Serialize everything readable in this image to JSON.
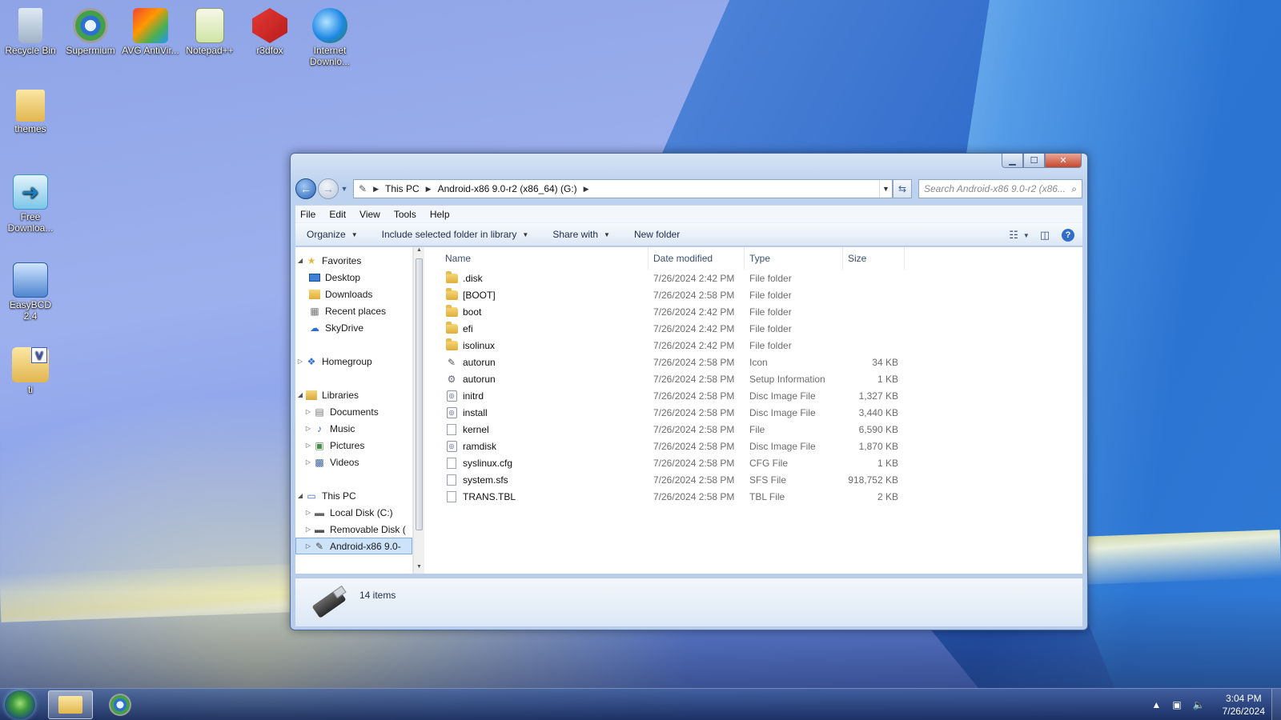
{
  "desktop": {
    "icons": [
      {
        "label": "Recycle Bin",
        "icon": "recycle-bin-icon"
      },
      {
        "label": "Supermium",
        "icon": "browser-icon"
      },
      {
        "label": "AVG AntiVir...",
        "icon": "antivirus-icon"
      },
      {
        "label": "Notepad++",
        "icon": "notepad-icon"
      },
      {
        "label": "r3dfox",
        "icon": "r3dfox-icon"
      },
      {
        "label": "Internet Downlo...",
        "icon": "download-manager-icon"
      },
      {
        "label": "themes",
        "icon": "folder-icon"
      },
      {
        "label": "Free Downloa...",
        "icon": "free-download-icon"
      },
      {
        "label": "EasyBCD 2.4",
        "icon": "easybcd-icon"
      },
      {
        "label": "ti",
        "icon": "folder-v-icon"
      }
    ]
  },
  "window": {
    "back_glyph": "←",
    "forward_glyph": "→",
    "breadcrumb": [
      "This PC",
      "Android-x86 9.0-r2 (x86_64) (G:)"
    ],
    "search_placeholder": "Search Android-x86 9.0-r2 (x86...",
    "menu": [
      "File",
      "Edit",
      "View",
      "Tools",
      "Help"
    ],
    "commands": {
      "organize": "Organize",
      "include": "Include selected folder in library",
      "share": "Share with",
      "new_folder": "New folder"
    },
    "nav": {
      "favorites": "Favorites",
      "desktop": "Desktop",
      "downloads": "Downloads",
      "recent": "Recent places",
      "skydrive": "SkyDrive",
      "homegroup": "Homegroup",
      "libraries": "Libraries",
      "documents": "Documents",
      "music": "Music",
      "pictures": "Pictures",
      "videos": "Videos",
      "thispc": "This PC",
      "localdisk": "Local Disk (C:)",
      "removable": "Removable Disk (",
      "android": "Android-x86 9.0-"
    },
    "columns": {
      "name": "Name",
      "date": "Date modified",
      "type": "Type",
      "size": "Size"
    },
    "files": [
      {
        "name": ".disk",
        "date": "7/26/2024 2:42 PM",
        "type": "File folder",
        "size": "",
        "icon": "folder"
      },
      {
        "name": "[BOOT]",
        "date": "7/26/2024 2:58 PM",
        "type": "File folder",
        "size": "",
        "icon": "folder"
      },
      {
        "name": "boot",
        "date": "7/26/2024 2:42 PM",
        "type": "File folder",
        "size": "",
        "icon": "folder"
      },
      {
        "name": "efi",
        "date": "7/26/2024 2:42 PM",
        "type": "File folder",
        "size": "",
        "icon": "folder"
      },
      {
        "name": "isolinux",
        "date": "7/26/2024 2:42 PM",
        "type": "File folder",
        "size": "",
        "icon": "folder"
      },
      {
        "name": "autorun",
        "date": "7/26/2024 2:58 PM",
        "type": "Icon",
        "size": "34 KB",
        "icon": "usb"
      },
      {
        "name": "autorun",
        "date": "7/26/2024 2:58 PM",
        "type": "Setup Information",
        "size": "1 KB",
        "icon": "gear"
      },
      {
        "name": "initrd",
        "date": "7/26/2024 2:58 PM",
        "type": "Disc Image File",
        "size": "1,327 KB",
        "icon": "disc"
      },
      {
        "name": "install",
        "date": "7/26/2024 2:58 PM",
        "type": "Disc Image File",
        "size": "3,440 KB",
        "icon": "disc"
      },
      {
        "name": "kernel",
        "date": "7/26/2024 2:58 PM",
        "type": "File",
        "size": "6,590 KB",
        "icon": "doc"
      },
      {
        "name": "ramdisk",
        "date": "7/26/2024 2:58 PM",
        "type": "Disc Image File",
        "size": "1,870 KB",
        "icon": "disc"
      },
      {
        "name": "syslinux.cfg",
        "date": "7/26/2024 2:58 PM",
        "type": "CFG File",
        "size": "1 KB",
        "icon": "doc"
      },
      {
        "name": "system.sfs",
        "date": "7/26/2024 2:58 PM",
        "type": "SFS File",
        "size": "918,752 KB",
        "icon": "doc"
      },
      {
        "name": "TRANS.TBL",
        "date": "7/26/2024 2:58 PM",
        "type": "TBL File",
        "size": "2 KB",
        "icon": "doc"
      }
    ],
    "status": "14 items"
  },
  "taskbar": {
    "time": "3:04 PM",
    "date": "7/26/2024"
  }
}
